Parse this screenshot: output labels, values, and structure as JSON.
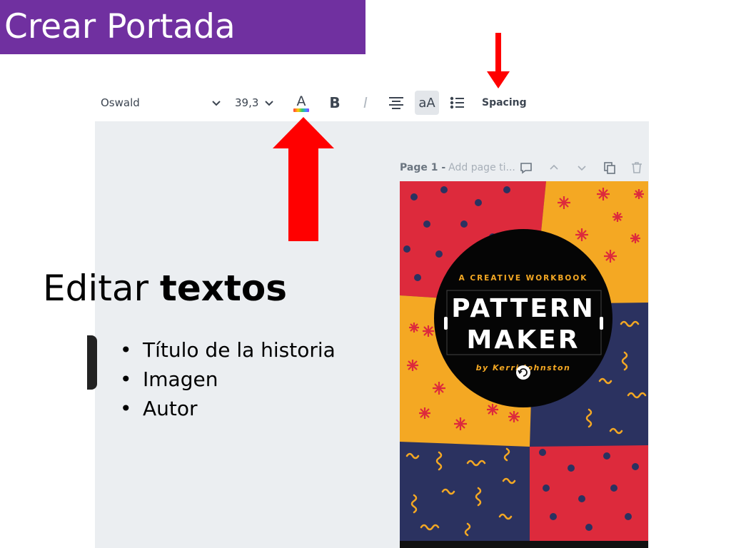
{
  "slide": {
    "title": "Crear Portada",
    "heading_regular": "Editar ",
    "heading_bold": "textos",
    "bullets": [
      "Título de la historia",
      "Imagen",
      "Autor"
    ]
  },
  "toolbar": {
    "font_name": "Oswald",
    "font_size": "39,3",
    "bold_label": "B",
    "italic_label": "I",
    "case_label": "aA",
    "spacing_label": "Spacing"
  },
  "page_header": {
    "page_label": "Page 1 -",
    "title_placeholder": "Add page ti..."
  },
  "design": {
    "subtitle": "A CREATIVE WORKBOOK",
    "title_line1": "PATTERN",
    "title_line2": "MAKER",
    "author": "by Kerri Johnston"
  },
  "colors": {
    "banner": "#7030a0",
    "arrow": "#ff0000",
    "red": "#dd2a3c",
    "yellow": "#f4a823",
    "navy": "#2b3260",
    "canvas": "#ebeef1"
  },
  "icons": [
    "chevron-down-icon",
    "text-color-icon",
    "bold-icon",
    "italic-icon",
    "align-center-icon",
    "case-icon",
    "list-icon",
    "comment-icon",
    "chevron-up-icon",
    "copy-icon",
    "trash-icon",
    "rotate-icon"
  ]
}
